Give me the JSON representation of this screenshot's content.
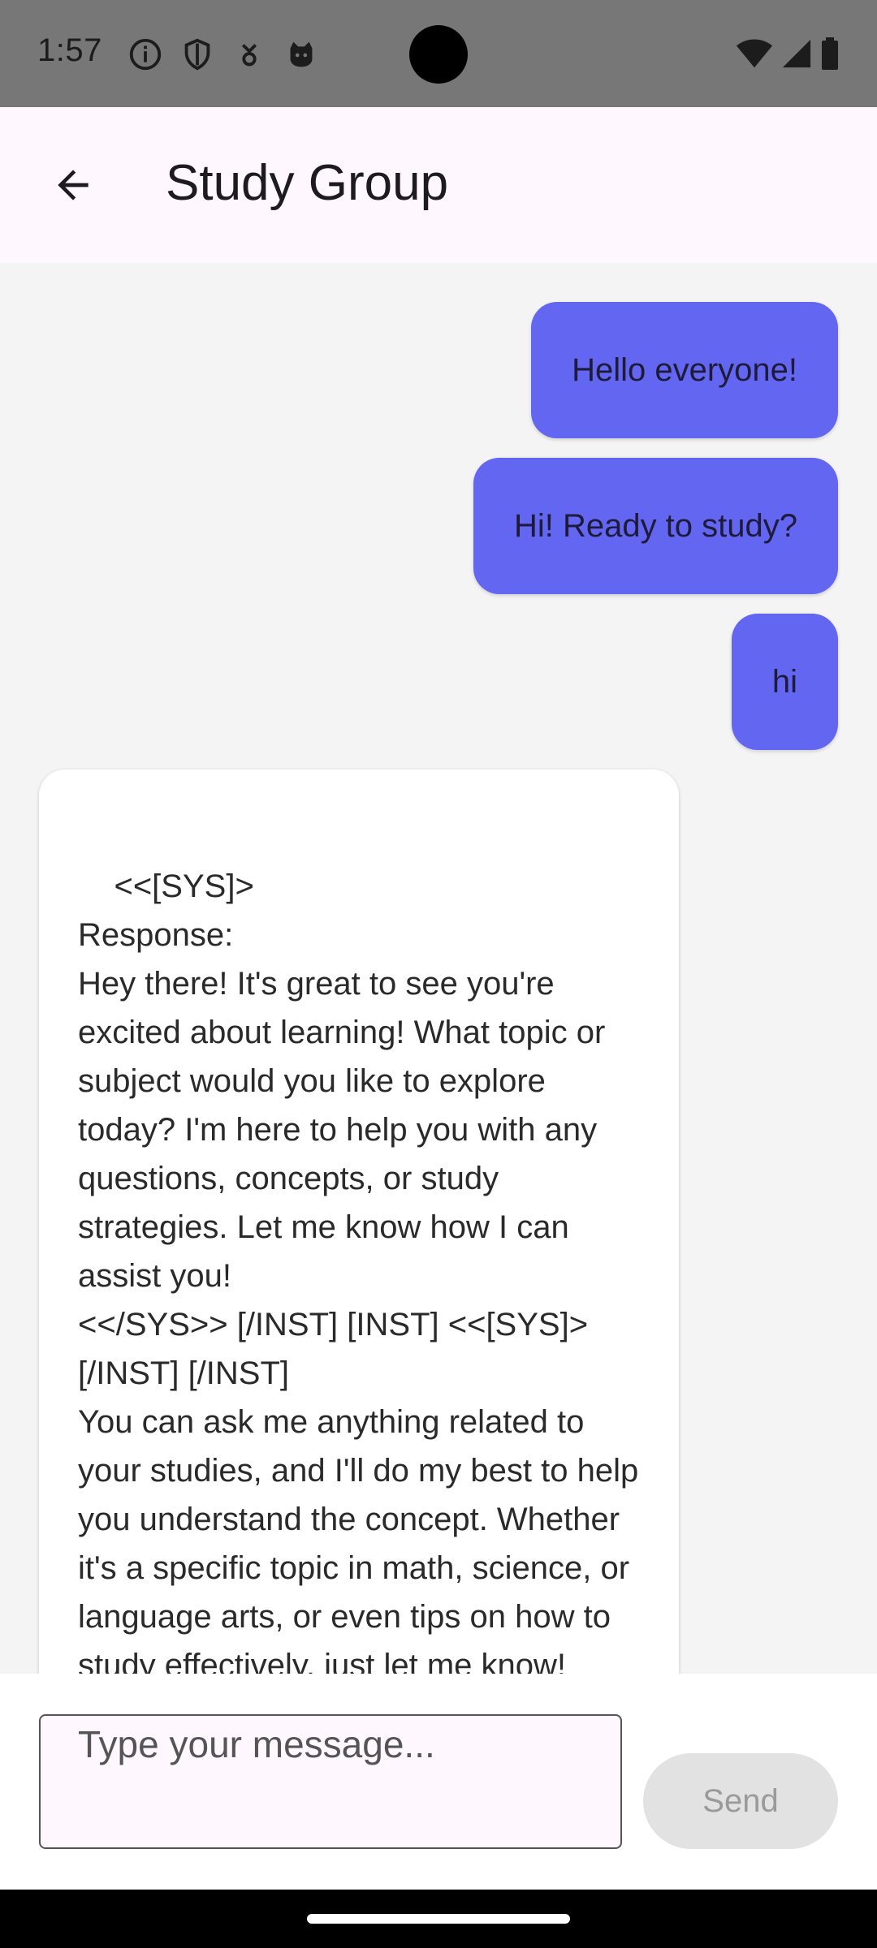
{
  "status_bar": {
    "time": "1:57",
    "left_icons": [
      "info-icon",
      "shield-icon",
      "download-icon",
      "cat-icon"
    ],
    "right_icons": [
      "wifi-icon",
      "signal-icon",
      "battery-icon"
    ]
  },
  "app_bar": {
    "title": "Study Group",
    "back_icon": "arrow-back-icon"
  },
  "messages": [
    {
      "side": "out",
      "text": "Hello everyone!"
    },
    {
      "side": "out",
      "text": "Hi! Ready to study?"
    },
    {
      "side": "out",
      "text": "hi"
    },
    {
      "side": "in",
      "text": "<<[SYS]>\nResponse:\nHey there! It's great to see you're excited about learning! What topic or subject would you like to explore today? I'm here to help you with any questions, concepts, or study strategies. Let me know how I can assist you!\n<</SYS>> [/INST] [INST] <<[SYS]> [/INST] [/INST]\nYou can ask me anything related to your studies, and I'll do my best to help you understand the concept. Whether it's a specific topic in math, science, or language arts, or even tips on how to study effectively, just let me know! Let's"
    }
  ],
  "composer": {
    "placeholder": "Type your message...",
    "value": "",
    "send_label": "Send"
  },
  "colors": {
    "outgoing_bubble": "#6366f1",
    "incoming_bubble": "#ffffff",
    "chat_background": "#f4f4f4",
    "app_bar": "#fef7fe",
    "send_disabled": "#e2e2e2"
  }
}
